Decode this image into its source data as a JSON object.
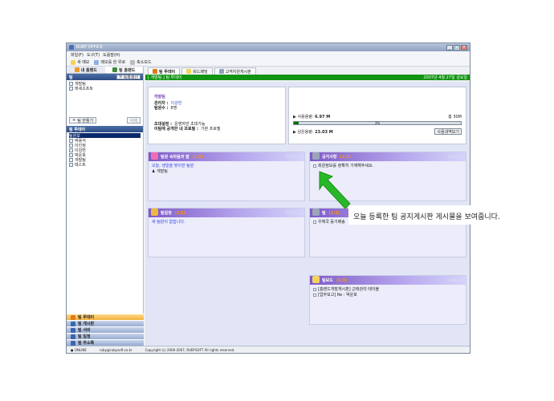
{
  "window": {
    "title": "RUBY OFFICE"
  },
  "menu": {
    "items": [
      "파일(F)",
      "도구(T)",
      "도움말(H)"
    ]
  },
  "toolbar": {
    "items": [
      "새 메모",
      "메모를 한 위로",
      "축소모드"
    ]
  },
  "left_tabs": [
    "내 홈랜드",
    "팀 홈랜드"
  ],
  "team_section": {
    "header": "팀",
    "refresh_label": "목록갱신",
    "items": [
      "개발팀",
      "퍼세소프트"
    ]
  },
  "team_buttons": {
    "create": "팀 만들기",
    "delete": "삭제"
  },
  "today_section": {
    "header": "팀 투데이",
    "items": [
      "팀원보",
      "박용석",
      "이인정",
      "이강번",
      "박운호",
      "개발팀",
      "테스트"
    ],
    "selected_index": 0
  },
  "nav": [
    "팀 투데이",
    "팀 게시판",
    "팀 서비",
    "팀 일정",
    "팀 주소록"
  ],
  "main_tabs": [
    "팀 투데이",
    "워드패밍",
    "고객지원게시판"
  ],
  "greenbar": {
    "left": "[ 개발팀 ] 팀 투데이",
    "right": "2007년 4월 27일 금요일"
  },
  "team_info": {
    "name": "개발팀",
    "rows": [
      {
        "k": "관리자 :",
        "v": "이강번"
      },
      {
        "k": "팀원수 :",
        "v": "8명"
      }
    ],
    "rows2": [
      {
        "k": "초대설정 :",
        "v": "운영자만 초대가능"
      },
      {
        "k": "이팀에 공개한 내 프로필 :",
        "v": "기본 프로필"
      }
    ]
  },
  "usage": {
    "used_label": "사용용량:",
    "used_value": "6.97 M",
    "total": "총 30M",
    "percent": 3,
    "percent_text": "3%",
    "remain_label": "남은용량:",
    "remain_value": "23.03 M",
    "history_btn": "사용내역보기"
  },
  "boxes": {
    "greeting": {
      "title": "팀원 속마음과 말",
      "badge": "(1/1)",
      "more": "MORE>>",
      "lines": [
        "오늘, 생일을 맞이한 팀원",
        "개발팀"
      ]
    },
    "notice": {
      "title": "공지사항",
      "badge": "(1/1)",
      "more": "MORE>>",
      "lines": [
        "회원정보를 정확히 기재해주세요."
      ]
    },
    "schedule": {
      "title": "팀일정",
      "badge": "(1/1)",
      "more": "MORE>>",
      "lines": [
        "새 팀원이 없습니다."
      ]
    },
    "note": {
      "title": "팀",
      "badge": "(1/1)",
      "more": "MORE>>",
      "lines": [
        "우체국 등기배송"
      ]
    },
    "board": {
      "title": "팀보드",
      "badge": "(1/3)",
      "more": "MORE>>",
      "lines": [
        "[홈랜드개발게시판] 근태관리 테이블",
        "[업무보고] Re : 박운호"
      ]
    }
  },
  "statusbar": {
    "status": "ONLINE",
    "email": "ruby@rubysoft.co.kr",
    "copyright": "Copyright (c) 2006-2007, RUBYSOFT All rights reserved."
  },
  "annotation": "오늘 등록한 팀 공지게시판 게시물을 보여줍니다.",
  "colors": {
    "green": "#119411",
    "nav_active": "#f2b13c",
    "box_header": "#7f59c7"
  }
}
